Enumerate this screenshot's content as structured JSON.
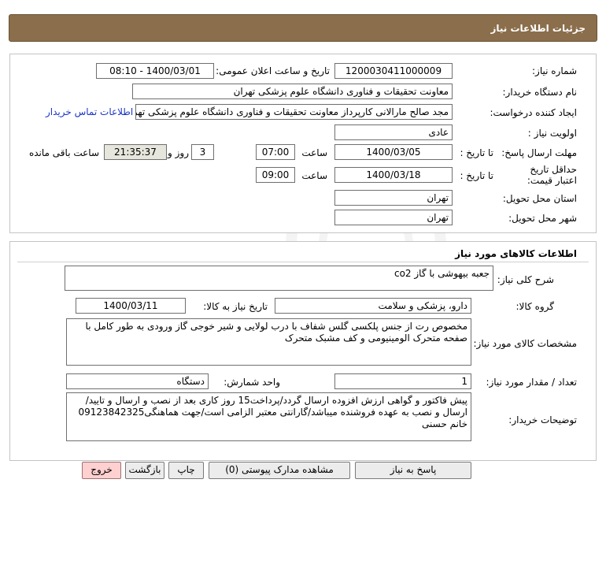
{
  "header": {
    "title": "جزئیات اطلاعات نیاز"
  },
  "info": {
    "need_number_label": "شماره نیاز:",
    "need_number": "1200030411000009",
    "announce_label": "تاریخ و ساعت اعلان عمومی:",
    "announce_value": "1400/03/01 - 08:10",
    "buyer_label": "نام دستگاه خریدار:",
    "buyer_value": "معاونت تحقیقات و فناوری دانشگاه علوم پزشکی تهران",
    "requester_label": "ایجاد کننده درخواست:",
    "requester_value": "مجد صالح مارالانی کارپرداز معاونت تحقیقات و فناوری دانشگاه علوم پزشکی تهران",
    "contact_link": "اطلاعات تماس خریدار",
    "priority_label": "اولویت نیاز :",
    "priority_value": "عادی",
    "deadline_label": "مهلت ارسال پاسخ:",
    "to_date_label": "تا تاریخ :",
    "deadline_date": "1400/03/05",
    "time_label": "ساعت",
    "deadline_time": "07:00",
    "days_value": "3",
    "days_label": "روز و",
    "remaining_value": "21:35:37",
    "remaining_label": "ساعت باقی مانده",
    "validity_label": "حداقل تاریخ اعتبار قیمت:",
    "validity_to_label": "تا تاریخ :",
    "validity_date": "1400/03/18",
    "validity_time_label": "ساعت",
    "validity_time": "09:00",
    "province_label": "استان محل تحویل:",
    "province_value": "تهران",
    "city_label": "شهر محل تحویل:",
    "city_value": "تهران"
  },
  "goods": {
    "section_title": "اطلاعات کالاهای مورد نیاز",
    "desc_label": "شرح کلی نیاز:",
    "desc_value": "جعبه بیهوشی با گاز co2",
    "group_label": "گروه کالا:",
    "group_value": "دارو، پزشکی و سلامت",
    "need_date_label": "تاریخ نیاز به کالا:",
    "need_date_value": "1400/03/11",
    "specs_label": "مشخصات کالای مورد نیاز:",
    "specs_value": "مخصوص رت از جنس پلکسی گلس شفاف با درب لولایی و شیر خوجی گاز ورودی به طور کامل با صفحه متحرک الومینیومی و کف مشبک متحرک",
    "qty_label": "تعداد / مقدار مورد نیاز:",
    "qty_value": "1",
    "unit_label": "واحد شمارش:",
    "unit_value": "دستگاه",
    "notes_label": "توضیحات خریدار:",
    "notes_value": "پیش فاکتور و گواهی ارزش افزوده ارسال گردد/پرداخت15 روز کاری بعد از نصب و ارسال و تایید/ارسال و نصب به عهده فروشنده میباشد/گارانتی معتبر الزامی است/جهت هماهنگی09123842325 خانم حسنی"
  },
  "actions": {
    "reply": "پاسخ به نیاز",
    "attachments": "مشاهده مدارک پیوستی (0)",
    "print": "چاپ",
    "back": "بازگشت",
    "exit": "خروج"
  }
}
